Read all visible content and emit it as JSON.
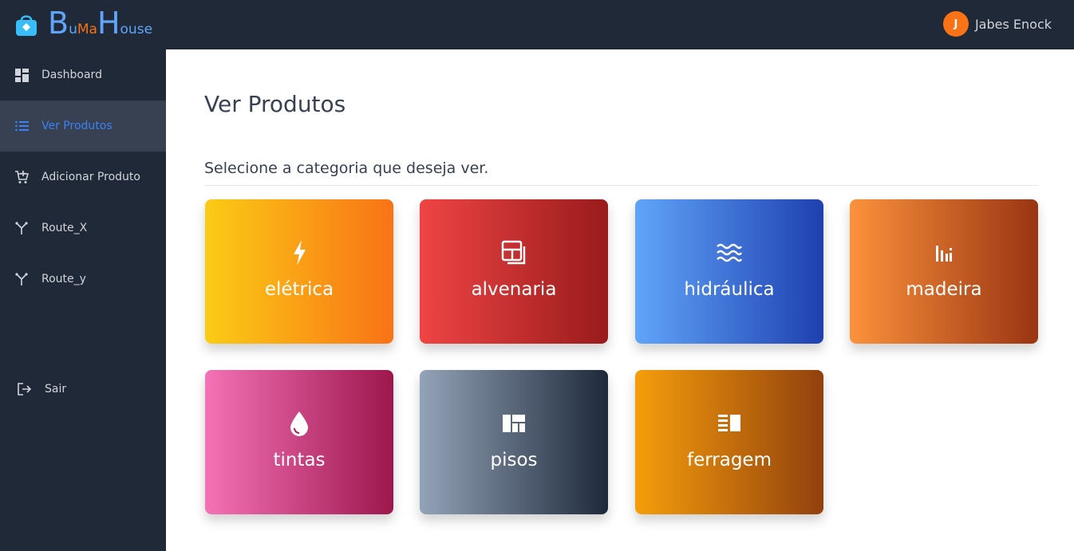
{
  "brand": {
    "part1": "B",
    "part2": "u",
    "part3": "Ma",
    "part4": "H",
    "part5": "ouse"
  },
  "user": {
    "initial": "J",
    "name": "Jabes Enock"
  },
  "sidebar": {
    "items": [
      {
        "label": "Dashboard",
        "icon": "dashboard-icon"
      },
      {
        "label": "Ver Produtos",
        "icon": "list-icon",
        "active": true
      },
      {
        "label": "Adicionar Produto",
        "icon": "cart-add-icon"
      },
      {
        "label": "Route_X",
        "icon": "route-icon"
      },
      {
        "label": "Route_y",
        "icon": "route-icon"
      }
    ],
    "logout": {
      "label": "Sair",
      "icon": "logout-icon"
    }
  },
  "main": {
    "title": "Ver Produtos",
    "subtitle": "Selecione a categoria que deseja ver."
  },
  "categories": [
    {
      "label": "elétrica",
      "icon": "lightning-icon",
      "colors": [
        "#facc15",
        "#f97316"
      ]
    },
    {
      "label": "alvenaria",
      "icon": "layout-icon",
      "colors": [
        "#ef4444",
        "#991b1b"
      ]
    },
    {
      "label": "hidráulica",
      "icon": "water-icon",
      "colors": [
        "#60a5fa",
        "#1e40af"
      ]
    },
    {
      "label": "madeira",
      "icon": "bars-icon",
      "colors": [
        "#fb923c",
        "#9a3412"
      ]
    },
    {
      "label": "tintas",
      "icon": "drop-icon",
      "colors": [
        "#f472b6",
        "#9d174d"
      ]
    },
    {
      "label": "pisos",
      "icon": "tiles-icon",
      "colors": [
        "#94a3b8",
        "#1e293b"
      ]
    },
    {
      "label": "ferragem",
      "icon": "panel-icon",
      "colors": [
        "#f59e0b",
        "#92400e"
      ]
    }
  ]
}
